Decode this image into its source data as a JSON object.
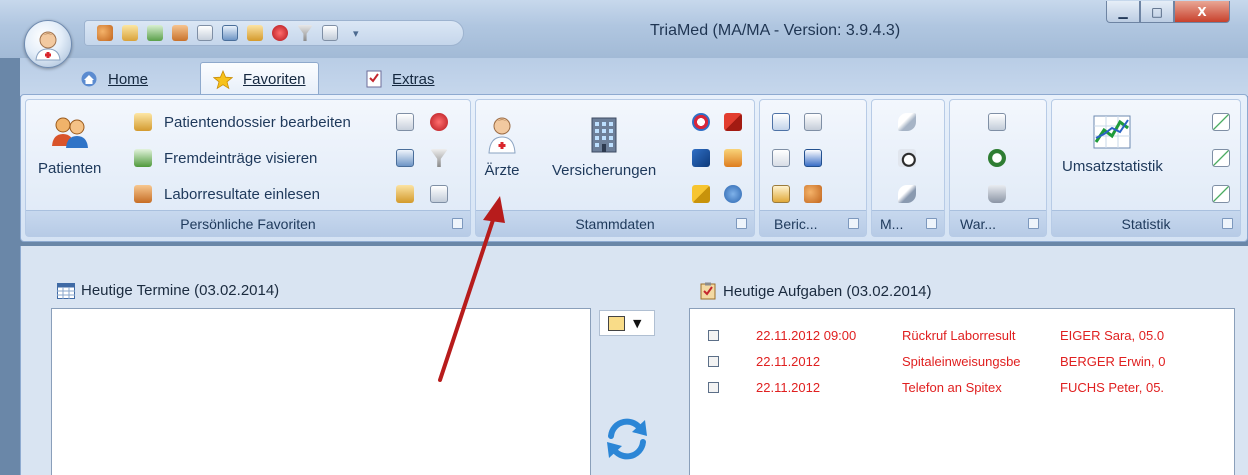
{
  "window": {
    "title": "TriaMed (MA/MA - Version: 3.9.4.3)",
    "controls": {
      "minimize": "▁",
      "maximize": "□",
      "close": "X"
    }
  },
  "quick_access": {
    "icons": [
      "patients-icon",
      "dossier-icon",
      "visa-icon",
      "lab-icon",
      "document-icon",
      "calendar-icon",
      "tag-icon",
      "heart-icon",
      "filter-icon",
      "report-icon"
    ],
    "more_glyph": "▾"
  },
  "tabs": [
    {
      "label": "Home",
      "icon": "home-icon",
      "active": false
    },
    {
      "label": "Favoriten",
      "icon": "star-icon",
      "active": true
    },
    {
      "label": "Extras",
      "icon": "checklist-icon",
      "active": false
    }
  ],
  "ribbon": {
    "favoriten": {
      "group_label": "Persönliche Favoriten",
      "big_button": "Patienten",
      "items": [
        "Patientendossier bearbeiten",
        "Fremdeinträge visieren",
        "Laborresultate einlesen"
      ]
    },
    "stammdaten": {
      "group_label": "Stammdaten",
      "buttons": [
        "Ärzte",
        "Versicherungen"
      ]
    },
    "berichte": {
      "group_label": "Beric..."
    },
    "medis": {
      "group_label": "M..."
    },
    "warte": {
      "group_label": "War..."
    },
    "statistik": {
      "group_label": "Statistik",
      "big_button": "Umsatzstatistik"
    }
  },
  "workspace": {
    "termine_title": "Heutige Termine (03.02.2014)",
    "aufgaben_title": "Heutige Aufgaben (03.02.2014)",
    "color_dropdown_glyph": "▼",
    "tasks": [
      {
        "date": "22.11.2012 09:00",
        "subject": "Rückruf Laborresult",
        "patient": "EIGER Sara, 05.0"
      },
      {
        "date": "22.11.2012",
        "subject": "Spitaleinweisungsbe",
        "patient": "BERGER Erwin, 0"
      },
      {
        "date": "22.11.2012",
        "subject": "Telefon an Spitex",
        "patient": "FUCHS Peter, 05."
      }
    ]
  },
  "colors": {
    "task_text": "#e02020",
    "annotation_arrow": "#b71c1c",
    "accent": "#1e395b"
  }
}
